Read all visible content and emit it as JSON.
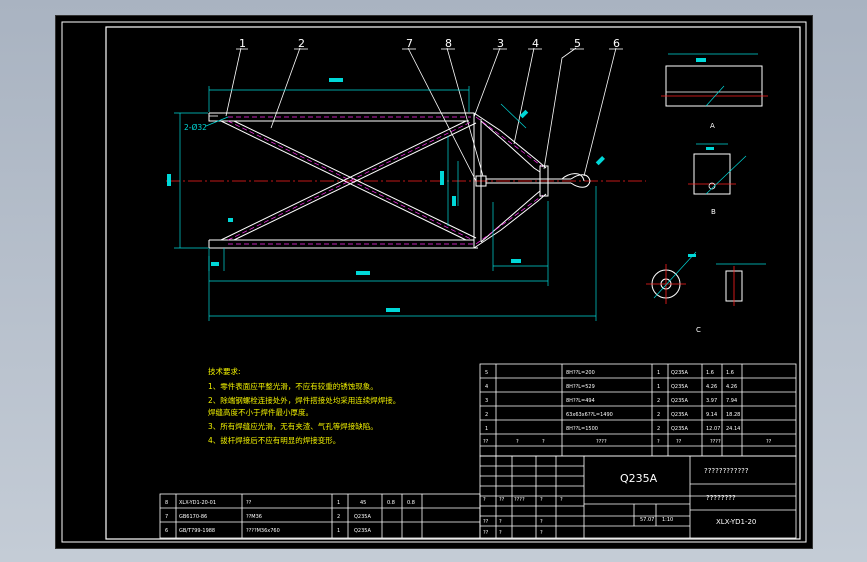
{
  "callouts": [
    "1",
    "2",
    "7",
    "8",
    "3",
    "4",
    "5",
    "6"
  ],
  "labels": {
    "hole_note": "2-Ø32",
    "view_a": "A",
    "view_b": "B",
    "view_c": "C"
  },
  "tech_requirements": {
    "title": "技术要求:",
    "items": [
      "1、零件表面应平整光滑，不应有较重的锈蚀现象。",
      "2、除端钢螺栓连接处外，焊件搭接处均采用连续焊焊接。",
      "   焊缝高度不小于焊件最小厚度。",
      "3、所有焊缝应光滑，无有夹渣、气孔等焊接缺陷。",
      "4、拔杆焊接后不应有明显的焊接变形。"
    ]
  },
  "parts_left": [
    {
      "no": "8",
      "code": "XLX-YD1-20-01",
      "name": "??",
      "qty": "1",
      "mat": "45",
      "w1": "0.8",
      "w2": "0.8"
    },
    {
      "no": "7",
      "code": "GB6170-86",
      "name": "??M36",
      "qty": "2",
      "mat": "Q235A",
      "w1": "",
      "w2": ""
    },
    {
      "no": "6",
      "code": "GB/T799-1988",
      "name": "????M36x760",
      "qty": "1",
      "mat": "Q235A",
      "w1": "",
      "w2": ""
    }
  ],
  "parts_right": [
    {
      "no": "5",
      "name": "8H??L=200",
      "qty": "1",
      "mat": "Q235A",
      "w1": "1.6",
      "w2": "1.6"
    },
    {
      "no": "4",
      "name": "8H??L=529",
      "qty": "1",
      "mat": "Q235A",
      "w1": "4.26",
      "w2": "4.26"
    },
    {
      "no": "3",
      "name": "8H??L=494",
      "qty": "2",
      "mat": "Q235A",
      "w1": "3.97",
      "w2": "7.94"
    },
    {
      "no": "2",
      "name": "63x63x6??L=1490",
      "qty": "2",
      "mat": "Q235A",
      "w1": "9.14",
      "w2": "18.28"
    },
    {
      "no": "1",
      "name": "8H??L=1500",
      "qty": "2",
      "mat": "Q235A",
      "w1": "12.07",
      "w2": "24.14"
    }
  ],
  "parts_header": [
    "??",
    "?",
    "?",
    "????",
    "?",
    "??",
    "????",
    "??"
  ],
  "title_block": {
    "material": "Q235A",
    "company": "????????????",
    "drawing_name": "????????",
    "drawing_no": "XLX-YD1-20",
    "mass": "57.07",
    "scale": "1:10",
    "sign_rows": [
      [
        "?",
        "??",
        "????",
        "?",
        "?"
      ],
      [
        "??",
        "?",
        "?"
      ],
      [
        "??",
        "?",
        "?"
      ]
    ]
  },
  "colors": {
    "frame": "#ffffff",
    "outline": "#ffffff",
    "magenta_line": "#ff2ef0",
    "dimension": "#00d8d8",
    "centerline": "#ff2020",
    "text_yellow": "#f2f200",
    "table": "#ffffff"
  }
}
